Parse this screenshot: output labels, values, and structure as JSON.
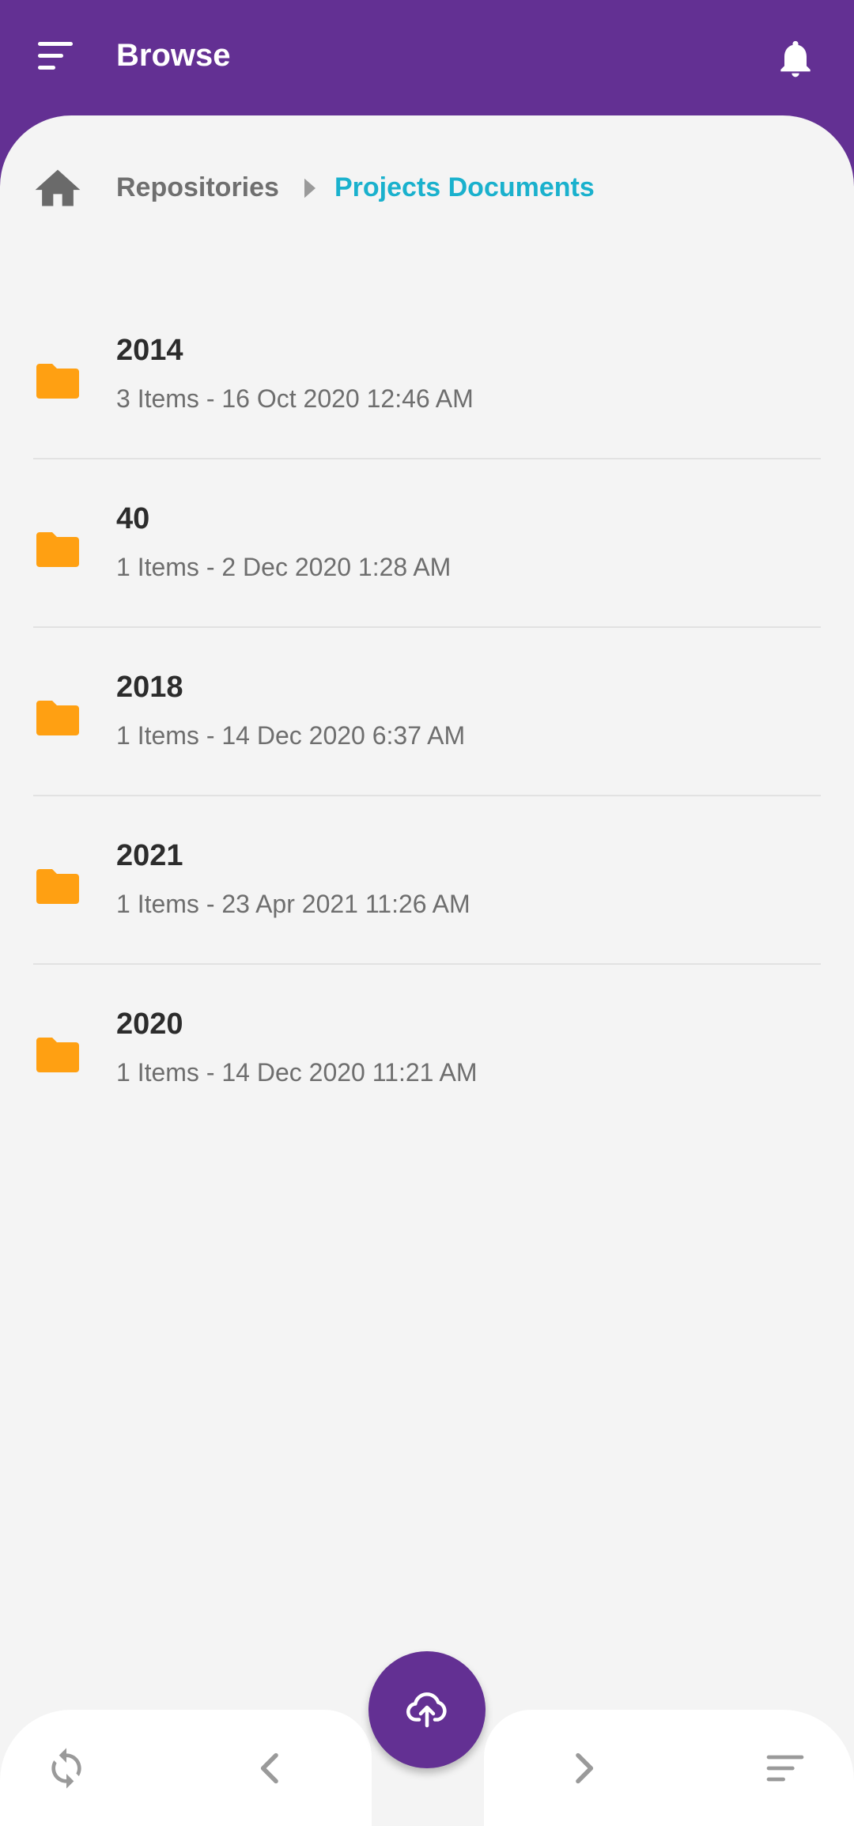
{
  "header": {
    "title": "Browse",
    "menu_icon": "menu-icon",
    "notification_icon": "bell-icon",
    "background_color": "#633093"
  },
  "breadcrumb": {
    "home_icon": "home-icon",
    "items": [
      "Repositories",
      "Projects Documents"
    ],
    "active_color": "#1ab1cd"
  },
  "folders": [
    {
      "name": "2014",
      "meta": "3 Items - 16 Oct 2020 12:46 AM"
    },
    {
      "name": "40",
      "meta": "1 Items - 2 Dec 2020 1:28 AM"
    },
    {
      "name": "2018",
      "meta": "1 Items - 14 Dec 2020 6:37 AM"
    },
    {
      "name": "2021",
      "meta": "1 Items - 23 Apr 2021 11:26 AM"
    },
    {
      "name": "2020",
      "meta": "1 Items - 14 Dec 2020 11:21 AM"
    }
  ],
  "folder_icon_color": "#ffa012",
  "bottom_nav": {
    "icons": [
      "refresh-icon",
      "chevron-left-icon",
      "chevron-right-icon",
      "sort-icon"
    ],
    "fab_icon": "cloud-upload-icon"
  }
}
